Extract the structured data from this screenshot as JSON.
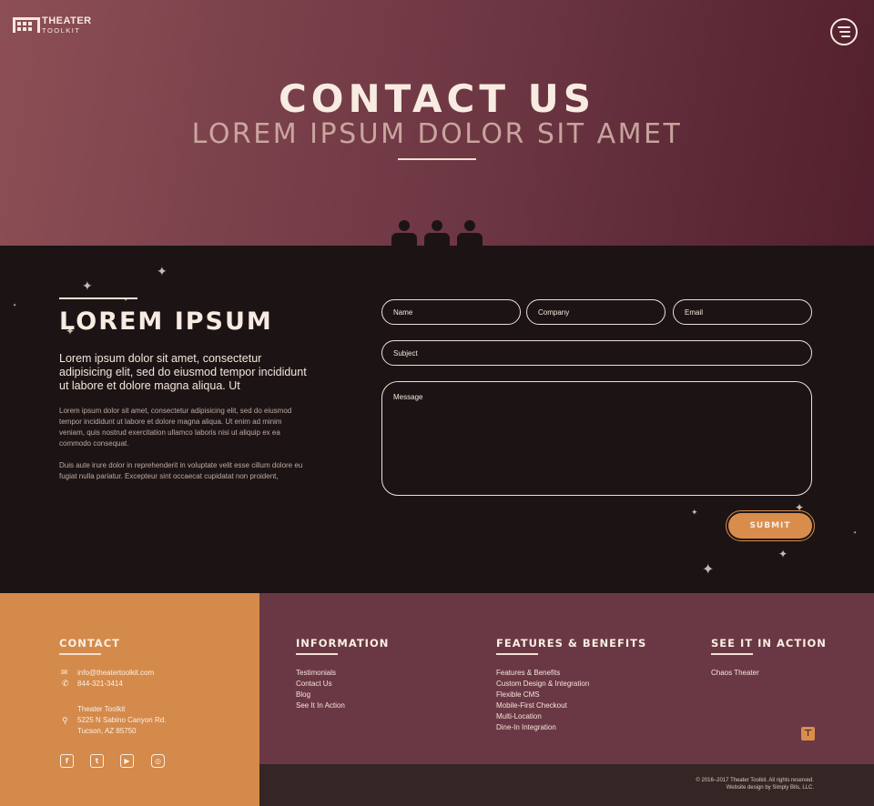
{
  "brand": {
    "line1": "THEATER",
    "line2": "TOOLKIT"
  },
  "hero": {
    "title": "CONTACT US",
    "subtitle": "LOREM IPSUM DOLOR SIT AMET"
  },
  "intro": {
    "heading": "LOREM IPSUM",
    "lead": "Lorem ipsum dolor sit amet, consectetur adipisicing elit, sed do eiusmod tempor incididunt ut labore et dolore magna aliqua. Ut",
    "para1": "Lorem ipsum dolor sit amet, consectetur adipisicing elit, sed do eiusmod tempor incididunt ut labore et dolore magna aliqua. Ut enim ad minim veniam, quis nostrud exercitation ullamco laboris nisi ut aliquip ex ea commodo consequat.",
    "para2": "Duis aute irure dolor in reprehenderit in voluptate velit esse cillum dolore eu fugiat nulla pariatur. Excepteur sint occaecat cupidatat non proident,"
  },
  "form": {
    "name": "Name",
    "company": "Company",
    "email": "Email",
    "subject": "Subject",
    "message": "Message",
    "submit": "SUBMIT"
  },
  "footer": {
    "contact": {
      "heading": "CONTACT",
      "email": "info@theatertoolkit.com",
      "phone": "844-321-3414",
      "addr_name": "Theater Toolkit",
      "addr_street": "5225 N Sabino Canyon Rd.",
      "addr_city": "Tucson, AZ 85750"
    },
    "information": {
      "heading": "INFORMATION",
      "links": [
        "Testimonials",
        "Contact Us",
        "Blog",
        "See It In Action"
      ]
    },
    "features": {
      "heading": "FEATURES & BENEFITS",
      "links": [
        "Features & Benefits",
        "Custom Design & Integration",
        "Flexible CMS",
        "Mobile-First Checkout",
        "Multi-Location",
        "Dine-In Integration"
      ]
    },
    "action": {
      "heading": "SEE IT IN ACTION",
      "links": [
        "Chaos Theater"
      ]
    },
    "copyright1": "© 2016–2017 Theater Toolkit. All rights reserved.",
    "copyright2": "Website design by Simply Bits, LLC."
  },
  "social": [
    "facebook-icon",
    "twitter-icon",
    "youtube-icon",
    "instagram-icon"
  ],
  "colors": {
    "hero": "#7a414b",
    "dark": "#1c1414",
    "accent": "#d98d4d",
    "plum": "#6a3844"
  }
}
